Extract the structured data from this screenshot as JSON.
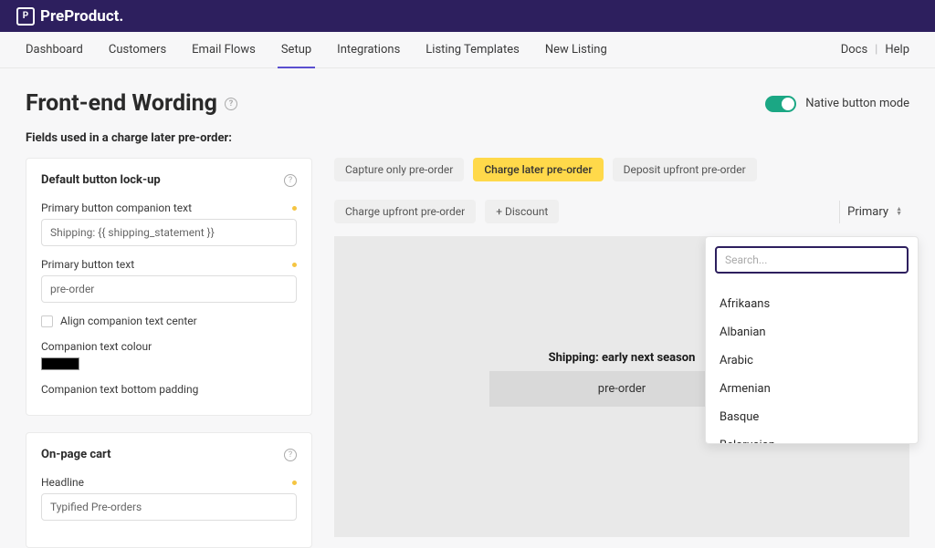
{
  "brand": "PreProduct.",
  "nav": {
    "items": [
      "Dashboard",
      "Customers",
      "Email Flows",
      "Setup",
      "Integrations",
      "Listing Templates",
      "New Listing"
    ],
    "active_index": 3,
    "right": {
      "docs": "Docs",
      "help": "Help"
    }
  },
  "page": {
    "title": "Front-end Wording",
    "toggle_label": "Native button mode",
    "subtitle": "Fields used in a charge later pre-order:"
  },
  "card_lockup": {
    "title": "Default button lock-up",
    "companion_label": "Primary button companion text",
    "companion_value": "Shipping: {{ shipping_statement }}",
    "button_label": "Primary button text",
    "button_value": "pre-order",
    "align_center": "Align companion text center",
    "colour_label": "Companion text colour",
    "padding_label": "Companion text bottom padding"
  },
  "card_cart": {
    "title": "On-page cart",
    "headline_label": "Headline",
    "headline_value": "Typified Pre-orders"
  },
  "tabs": {
    "items": [
      "Capture only pre-order",
      "Charge later pre-order",
      "Deposit upfront pre-order",
      "Charge upfront pre-order",
      "+ Discount"
    ],
    "active_index": 1,
    "primary_label": "Primary"
  },
  "preview": {
    "companion": "Shipping: early next season",
    "button": "pre-order"
  },
  "dropdown": {
    "search_placeholder": "Search...",
    "items": [
      "Afrikaans",
      "Albanian",
      "Arabic",
      "Armenian",
      "Basque",
      "Belarusian"
    ]
  }
}
